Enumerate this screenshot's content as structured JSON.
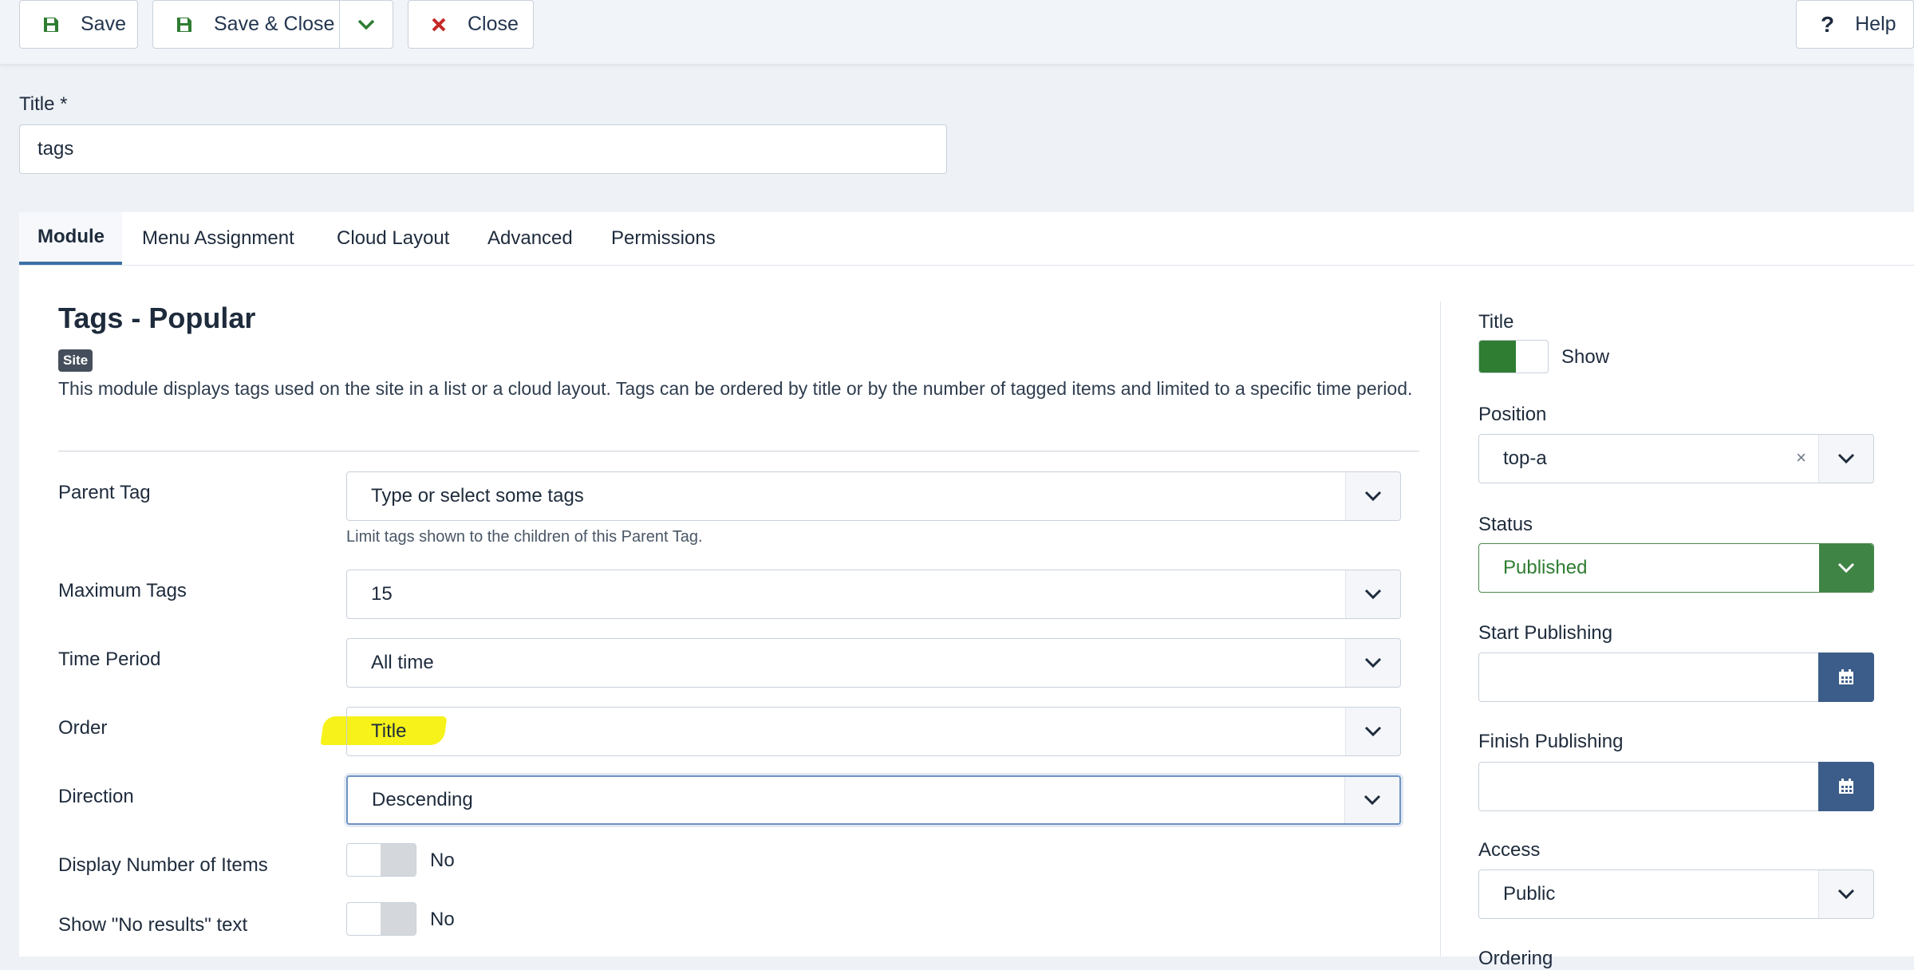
{
  "toolbar": {
    "save_label": "Save",
    "save_close_label": "Save & Close",
    "close_label": "Close",
    "help_label": "Help"
  },
  "title_field": {
    "label": "Title *",
    "value": "tags"
  },
  "tabs": [
    {
      "label": "Module"
    },
    {
      "label": "Menu Assignment"
    },
    {
      "label": "Cloud Layout"
    },
    {
      "label": "Advanced"
    },
    {
      "label": "Permissions"
    }
  ],
  "module": {
    "heading": "Tags - Popular",
    "badge": "Site",
    "description": "This module displays tags used on the site in a list or a cloud layout. Tags can be ordered by title or by the number of tagged items and limited to a specific time period."
  },
  "fields": {
    "parent_tag": {
      "label": "Parent Tag",
      "placeholder": "Type or select some tags",
      "hint": "Limit tags shown to the children of this Parent Tag."
    },
    "maximum_tags": {
      "label": "Maximum Tags",
      "value": "15"
    },
    "time_period": {
      "label": "Time Period",
      "value": "All time"
    },
    "order": {
      "label": "Order",
      "value": "Title"
    },
    "direction": {
      "label": "Direction",
      "value": "Descending"
    },
    "display_number": {
      "label": "Display Number of Items",
      "value": "No"
    },
    "no_results": {
      "label": "Show \"No results\" text",
      "value": "No"
    }
  },
  "sidebar": {
    "title": {
      "label": "Title",
      "value": "Show"
    },
    "position": {
      "label": "Position",
      "value": "top-a"
    },
    "status": {
      "label": "Status",
      "value": "Published"
    },
    "start_publishing": {
      "label": "Start Publishing"
    },
    "finish_publishing": {
      "label": "Finish Publishing"
    },
    "access": {
      "label": "Access",
      "value": "Public"
    },
    "ordering": {
      "label": "Ordering"
    }
  },
  "colors": {
    "accent": "#3a6ea5",
    "published": "#2f7d32",
    "calendar_button": "#3c5d89",
    "highlight": "#f6f21a"
  },
  "icons": [
    "save-icon",
    "chevron-down-icon",
    "close-icon",
    "help-icon",
    "calendar-icon",
    "clear-icon"
  ]
}
